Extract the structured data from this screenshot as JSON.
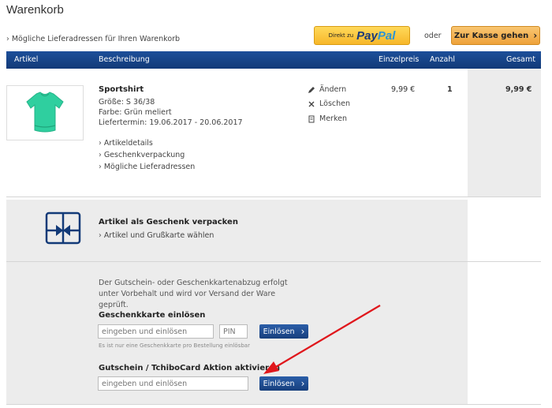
{
  "page": {
    "title": "Warenkorb",
    "addresses_link": "Mögliche Lieferadressen für Ihren Warenkorb",
    "paypal": {
      "prefix": "Direkt zu",
      "brand_pay": "Pay",
      "brand_pal": "Pal"
    },
    "or": "oder",
    "checkout_label": "Zur Kasse gehen"
  },
  "table": {
    "headers": [
      "Artikel",
      "Beschreibung",
      "Einzelpreis",
      "Anzahl",
      "Gesamt"
    ]
  },
  "item": {
    "name": "Sportshirt",
    "size": "Größe: S 36/38",
    "color": "Farbe: Grün meliert",
    "delivery": "Liefertermin: 19.06.2017 - 20.06.2017",
    "links": [
      "Artikeldetails",
      "Geschenkverpackung",
      "Mögliche Lieferadressen"
    ],
    "actions": [
      {
        "label": "Ändern",
        "icon": "pencil-icon"
      },
      {
        "label": "Löschen",
        "icon": "close-icon"
      },
      {
        "label": "Merken",
        "icon": "notepad-icon"
      }
    ],
    "unit_price": "9,99 €",
    "quantity": "1",
    "total_price": "9,99 €"
  },
  "gift": {
    "title": "Artikel als Geschenk verpacken",
    "link": "Artikel und Grußkarte wählen"
  },
  "voucher": {
    "note": "Der Gutschein- oder Geschenkkartenabzug erfolgt unter Vorbehalt und wird vor Versand der Ware geprüft.",
    "giftcard_title": "Geschenkkarte einlösen",
    "giftcard_placeholder": "eingeben und einlösen",
    "pin_placeholder": "PIN",
    "redeem_label": "Einlösen",
    "giftcard_hint": "Es ist nur eine Geschenkkarte pro Bestellung einlösbar",
    "coupon_title": "Gutschein / TchiboCard Aktion aktivieren",
    "coupon_placeholder": "eingeben und einlösen"
  },
  "colors": {
    "header_blue": "#1d4f9a",
    "paypal_yellow": "#ffd95a",
    "checkout_orange": "#eea23a",
    "annotation_red": "#e0171c",
    "shirt_green": "#2fcf9f"
  }
}
